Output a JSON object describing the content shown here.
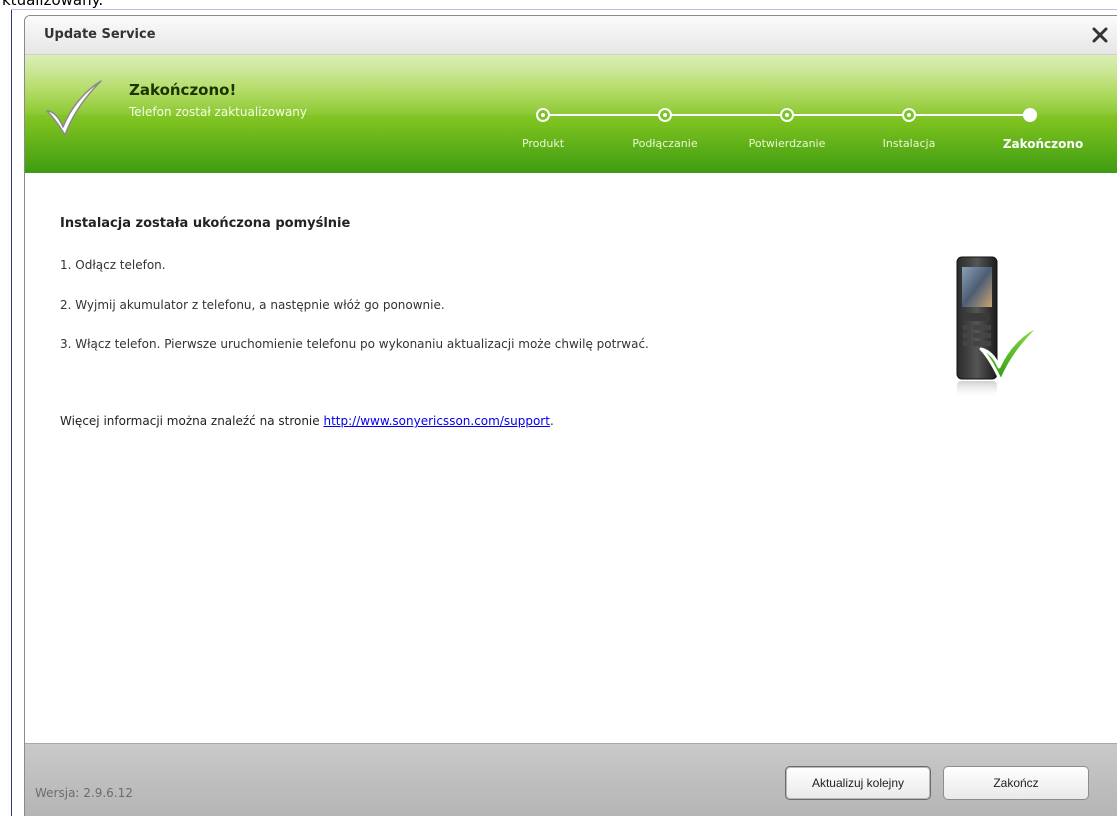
{
  "page_top_text": "ktualizowany.",
  "window": {
    "title": "Update Service",
    "close_label": "✕"
  },
  "header": {
    "status_title": "Zakończono!",
    "status_subtitle": "Telefon został zaktualizowany",
    "steps": [
      {
        "label": "Produkt",
        "state": "done"
      },
      {
        "label": "Podłączanie",
        "state": "done"
      },
      {
        "label": "Potwierdzanie",
        "state": "done"
      },
      {
        "label": "Instalacja",
        "state": "done"
      },
      {
        "label": "Zakończono",
        "state": "current"
      }
    ]
  },
  "content": {
    "heading": "Instalacja została ukończona pomyślnie",
    "instructions": [
      "1. Odłącz telefon.",
      "2. Wyjmij akumulator z telefonu, a następnie włóż go ponownie.",
      "3. Włącz telefon. Pierwsze uruchomienie telefonu po wykonaniu aktualizacji może chwilę potrwać."
    ],
    "more_info_prefix": "Więcej informacji można znaleźć na stronie ",
    "more_info_link": "http://www.sonyericsson.com/support",
    "more_info_suffix": "."
  },
  "footer": {
    "version": "Wersja: 2.9.6.12",
    "update_another_label": "Aktualizuj kolejny",
    "finish_label": "Zakończ"
  },
  "colors": {
    "header_green": "#78bf1e",
    "header_dark_green": "#3e9c12",
    "link_blue": "#0000ee",
    "footer_gray": "#b4b4b4"
  },
  "icons": {
    "close": "close-icon",
    "header_check": "checkmark-icon",
    "phone": "phone-with-checkmark-icon"
  }
}
